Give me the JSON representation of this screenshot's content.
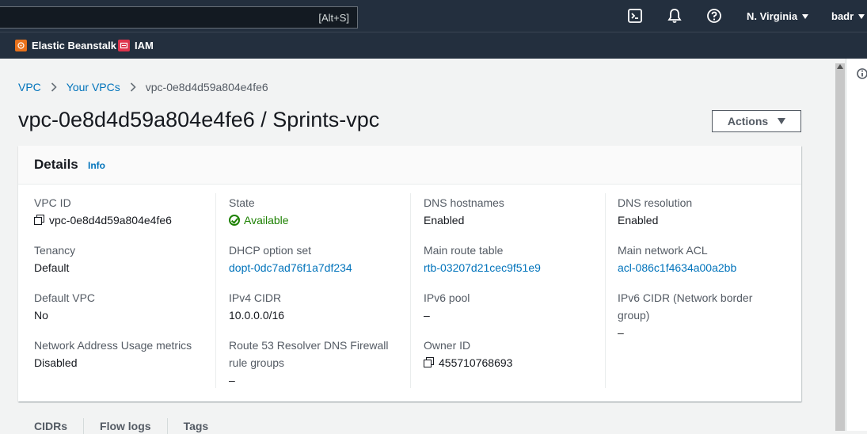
{
  "topnav": {
    "search_hint": "[Alt+S]",
    "region": "N. Virginia",
    "user": "badr",
    "icons": [
      "terminal-icon",
      "bell-icon",
      "help-icon"
    ]
  },
  "favorites": [
    {
      "label": "Elastic Beanstalk",
      "icon": "elastic-beanstalk-icon",
      "color": "#e7711b"
    },
    {
      "label": "IAM",
      "icon": "iam-icon",
      "color": "#dd344c"
    }
  ],
  "breadcrumb": {
    "items": [
      "VPC",
      "Your VPCs"
    ],
    "current": "vpc-0e8d4d59a804e4fe6"
  },
  "page": {
    "title": "vpc-0e8d4d59a804e4fe6 / Sprints-vpc",
    "actions_label": "Actions"
  },
  "details": {
    "title": "Details",
    "info": "Info",
    "fields": {
      "vpc_id": {
        "label": "VPC ID",
        "value": "vpc-0e8d4d59a804e4fe6"
      },
      "state": {
        "label": "State",
        "value": "Available"
      },
      "dns_hostnames": {
        "label": "DNS hostnames",
        "value": "Enabled"
      },
      "dns_resolution": {
        "label": "DNS resolution",
        "value": "Enabled"
      },
      "tenancy": {
        "label": "Tenancy",
        "value": "Default"
      },
      "dhcp": {
        "label": "DHCP option set",
        "value": "dopt-0dc7ad76f1a7df234"
      },
      "main_route_table": {
        "label": "Main route table",
        "value": "rtb-03207d21cec9f51e9"
      },
      "main_network_acl": {
        "label": "Main network ACL",
        "value": "acl-086c1f4634a00a2bb"
      },
      "default_vpc": {
        "label": "Default VPC",
        "value": "No"
      },
      "ipv4_cidr": {
        "label": "IPv4 CIDR",
        "value": "10.0.0.0/16"
      },
      "ipv6_pool": {
        "label": "IPv6 pool",
        "value": "–"
      },
      "ipv6_cidr": {
        "label_line1": "IPv6 CIDR (Network border",
        "label_line2": "group)",
        "value": "–"
      },
      "nau_metrics": {
        "label": "Network Address Usage metrics",
        "value": "Disabled"
      },
      "route53": {
        "label_line1": "Route 53 Resolver DNS Firewall",
        "label_line2": "rule groups",
        "value": "–"
      },
      "owner_id": {
        "label": "Owner ID",
        "value": "455710768693"
      }
    }
  },
  "tabs": [
    "CIDRs",
    "Flow logs",
    "Tags"
  ],
  "colors": {
    "accent": "#0073bb",
    "nav": "#232f3e",
    "success": "#1d8102"
  }
}
